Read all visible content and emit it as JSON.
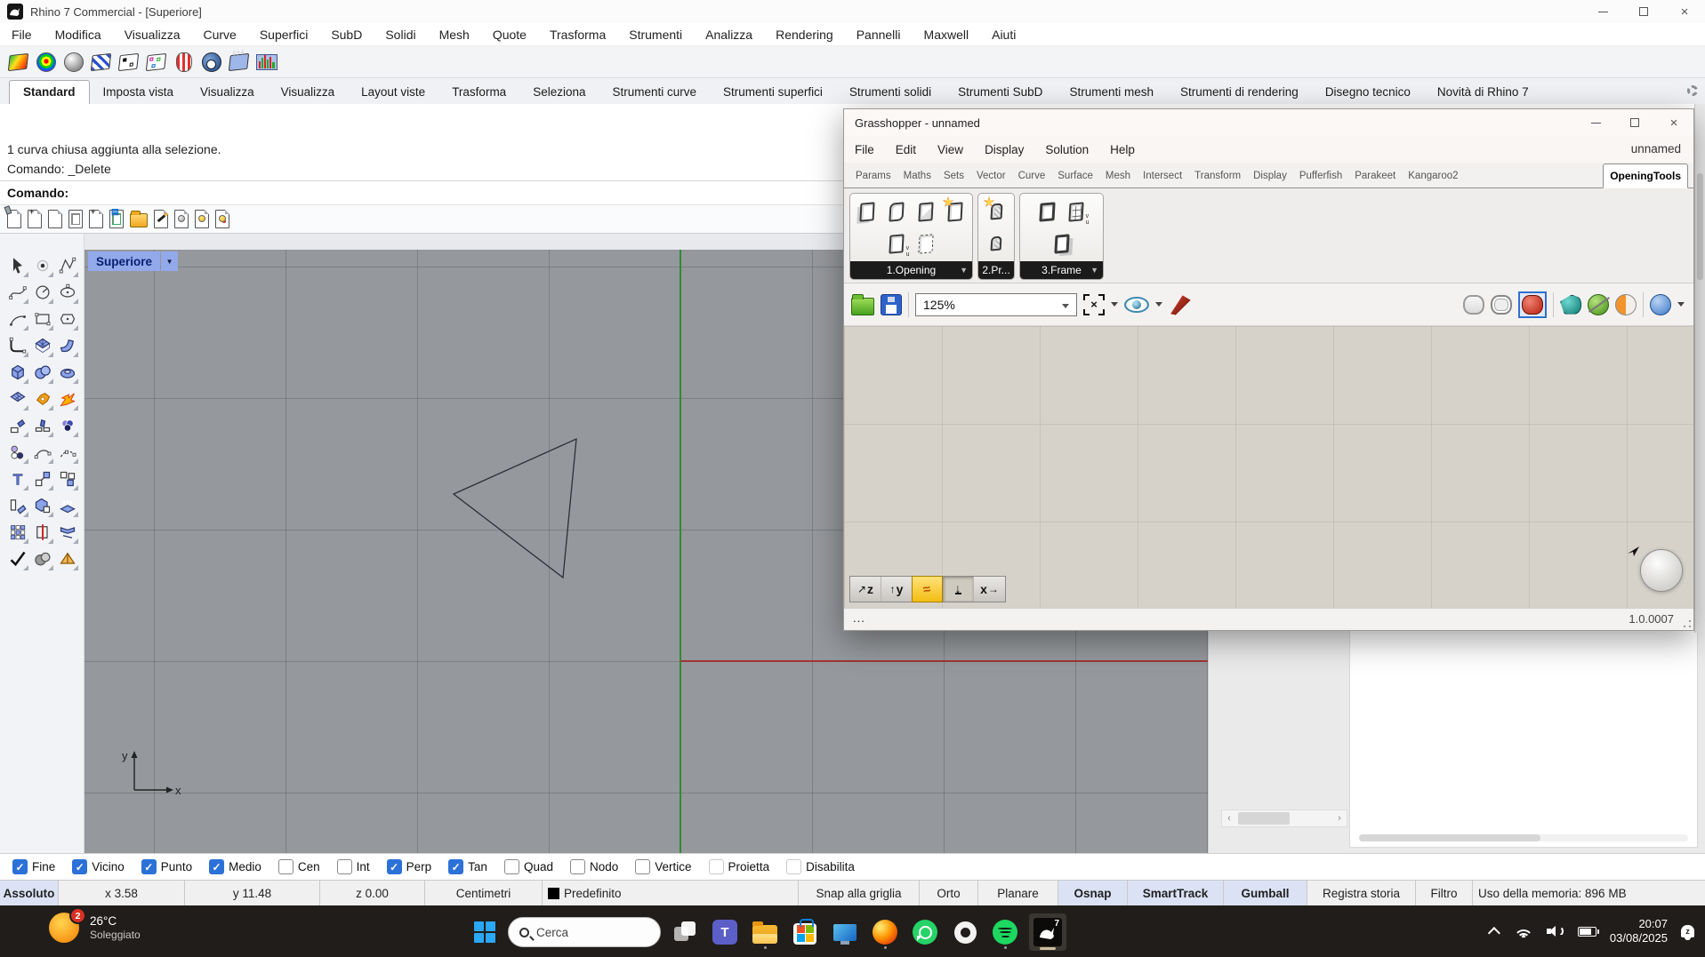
{
  "colors": {
    "checkbox_blue": "#2c71d8",
    "viewport_bg": "#95989c",
    "axis_y_green": "#2f8b35",
    "axis_x_red": "#9e3636",
    "gh_canvas_bg": "#d6d2ca",
    "taskbar_bg": "#211d1a",
    "status_highlight": "#dbe2f4"
  },
  "rhino": {
    "window_title": "Rhino 7 Commercial - [Superiore]",
    "menus": [
      "File",
      "Modifica",
      "Visualizza",
      "Curve",
      "Superfici",
      "SubD",
      "Solidi",
      "Mesh",
      "Quote",
      "Trasforma",
      "Strumenti",
      "Analizza",
      "Rendering",
      "Pannelli",
      "Maxwell",
      "Aiuti"
    ],
    "tabs": [
      "Standard",
      "Imposta vista",
      "Visualizza",
      "Visualizza",
      "Layout viste",
      "Trasforma",
      "Seleziona",
      "Strumenti curve",
      "Strumenti superfici",
      "Strumenti solidi",
      "Strumenti SubD",
      "Strumenti mesh",
      "Strumenti di rendering",
      "Disegno tecnico",
      "Novità di Rhino 7"
    ],
    "active_tab": "Standard",
    "history_line1": "1 curva chiusa aggiunta alla selezione.",
    "history_line2": "Comando: _Delete",
    "prompt": "Comando:",
    "toolbar1_icons": [
      "gradient-swatch-icon",
      "rainbow-sphere-icon",
      "gray-sphere-icon",
      "zebra-analysis-icon",
      "spot-map-icon",
      "environment-map-icon",
      "striped-can-icon",
      "camera-sphere-icon",
      "draft-angle-icon",
      "histogram-icon"
    ],
    "toolbar2_icons": [
      "spray-document-icon",
      "new-document-icon",
      "blank-document-icon",
      "window-document-icon",
      "stack-document-icon",
      "layout-document-icon",
      "open-folder-icon",
      "pencil-document-icon",
      "bulb-document-icon",
      "yellow-bulb-document-icon",
      "color-bulb-document-icon"
    ],
    "sidebar_tools": [
      "select",
      "point",
      "polyline",
      "control-curve",
      "circle",
      "ellipse",
      "arc",
      "rectangle",
      "polygon",
      "fillet",
      "surface-points",
      "bend-surface",
      "box",
      "boolean-spheres",
      "torus",
      "mesh-surface",
      "boolean-union",
      "explode",
      "trim",
      "split",
      "color-blend",
      "point-cloud",
      "blend-curve",
      "extend-curve",
      "text-object",
      "move",
      "copy",
      "scale",
      "solid-union",
      "extrude",
      "array",
      "distribute",
      "twist",
      "check-select",
      "shade",
      "render-pyramid"
    ],
    "viewport": {
      "label": "Superiore",
      "axis_x": "x",
      "axis_y": "y"
    },
    "osnap": [
      {
        "label": "Fine",
        "checked": true
      },
      {
        "label": "Vicino",
        "checked": true
      },
      {
        "label": "Punto",
        "checked": true
      },
      {
        "label": "Medio",
        "checked": true
      },
      {
        "label": "Cen",
        "checked": false
      },
      {
        "label": "Int",
        "checked": false
      },
      {
        "label": "Perp",
        "checked": true
      },
      {
        "label": "Tan",
        "checked": true
      },
      {
        "label": "Quad",
        "checked": false
      },
      {
        "label": "Nodo",
        "checked": false
      },
      {
        "label": "Vertice",
        "checked": false
      },
      {
        "label": "Proietta",
        "checked": false
      },
      {
        "label": "Disabilita",
        "checked": false
      }
    ],
    "status": [
      {
        "label": "Assoluto"
      },
      {
        "label": "x 3.58"
      },
      {
        "label": "y 11.48"
      },
      {
        "label": "z 0.00"
      },
      {
        "label": "Centimetri"
      },
      {
        "label": "Predefinito"
      },
      {
        "label": "Snap alla griglia"
      },
      {
        "label": "Orto"
      },
      {
        "label": "Planare"
      },
      {
        "label": "Osnap"
      },
      {
        "label": "SmartTrack"
      },
      {
        "label": "Gumball"
      },
      {
        "label": "Registra storia"
      },
      {
        "label": "Filtro"
      },
      {
        "label": "Uso della memoria: 896 MB"
      }
    ]
  },
  "grasshopper": {
    "title": "Grasshopper - unnamed",
    "menus": [
      "File",
      "Edit",
      "View",
      "Display",
      "Solution",
      "Help"
    ],
    "doc_label": "unnamed",
    "tabs": [
      "Params",
      "Maths",
      "Sets",
      "Vector",
      "Curve",
      "Surface",
      "Mesh",
      "Intersect",
      "Transform",
      "Display",
      "Pufferfish",
      "Parakeet",
      "Kangaroo2",
      "OpeningTools"
    ],
    "active_tab": "OpeningTools",
    "groups": [
      {
        "label": "1.Opening"
      },
      {
        "label": "2.Pr..."
      },
      {
        "label": "3.Frame"
      }
    ],
    "zoom_value": "125%",
    "toolbar_icons": [
      "open-file-icon",
      "save-file-icon",
      "zoom-extents-icon",
      "preview-eye-icon",
      "sketch-pen-icon",
      "wireframe-preview-icon",
      "ghosted-preview-icon",
      "shaded-preview-icon",
      "preview-arrow-icon",
      "disable-preview-icon",
      "half-preview-icon",
      "blue-sphere-icon"
    ],
    "mini_toolbar_icons": [
      "align-z-icon",
      "align-y-icon",
      "sketch-icon",
      "export-tray-icon",
      "align-x-icon"
    ],
    "status_left": "...",
    "status_right": "1.0.0007"
  },
  "taskbar": {
    "weather_temp": "26°C",
    "weather_cond": "Soleggiato",
    "badge": "2",
    "search_placeholder": "Cerca",
    "apps": [
      "task-view",
      "teams",
      "file-explorer",
      "microsoft-store",
      "remote-desktop",
      "firefox",
      "whatsapp",
      "chatgpt",
      "spotify",
      "rhino"
    ],
    "tray": [
      "chevron-up",
      "wifi",
      "volume",
      "battery"
    ],
    "time": "20:07",
    "date": "03/08/2025"
  }
}
